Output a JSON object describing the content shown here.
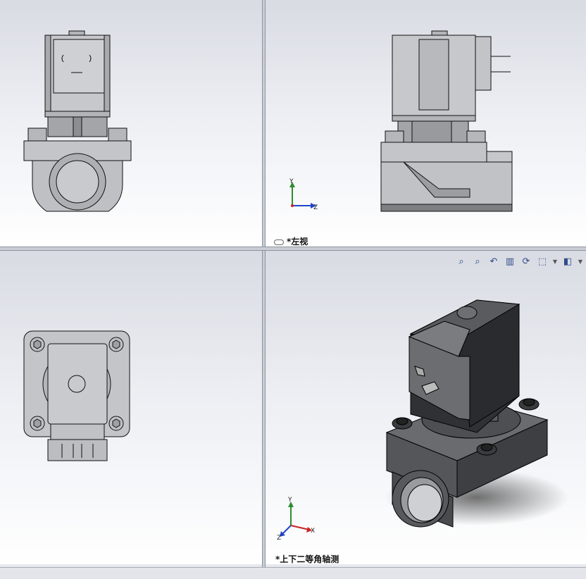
{
  "viewports": {
    "top_left": {
      "name": "front view"
    },
    "top_right": {
      "label": "*左视"
    },
    "bottom_left": {
      "name": "top view"
    },
    "bottom_right": {
      "label": "*上下二等角轴测"
    }
  },
  "triad": {
    "left_view": {
      "y": "Y",
      "z": "Z"
    },
    "iso_view": {
      "y": "Y",
      "x": "X",
      "z": "Z"
    }
  },
  "heads_up_toolbar": [
    {
      "name": "zoom-to-fit-icon",
      "glyph": "⌕"
    },
    {
      "name": "zoom-to-area-icon",
      "glyph": "⌕"
    },
    {
      "name": "previous-view-icon",
      "glyph": "↶"
    },
    {
      "name": "section-view-icon",
      "glyph": "▥"
    },
    {
      "name": "dynamic-annotation-icon",
      "glyph": "⟳"
    },
    {
      "name": "view-orientation-icon",
      "glyph": "⬚"
    },
    {
      "name": "display-style-icon",
      "glyph": "◧"
    }
  ],
  "colors": {
    "body_light": "#c9cacd",
    "body_mid": "#a9aaad",
    "body_dark": "#4a4b4e",
    "edge": "#111111",
    "triad_y": "#2e8b2e",
    "triad_z": "#2244cc",
    "triad_x": "#cc2222"
  }
}
